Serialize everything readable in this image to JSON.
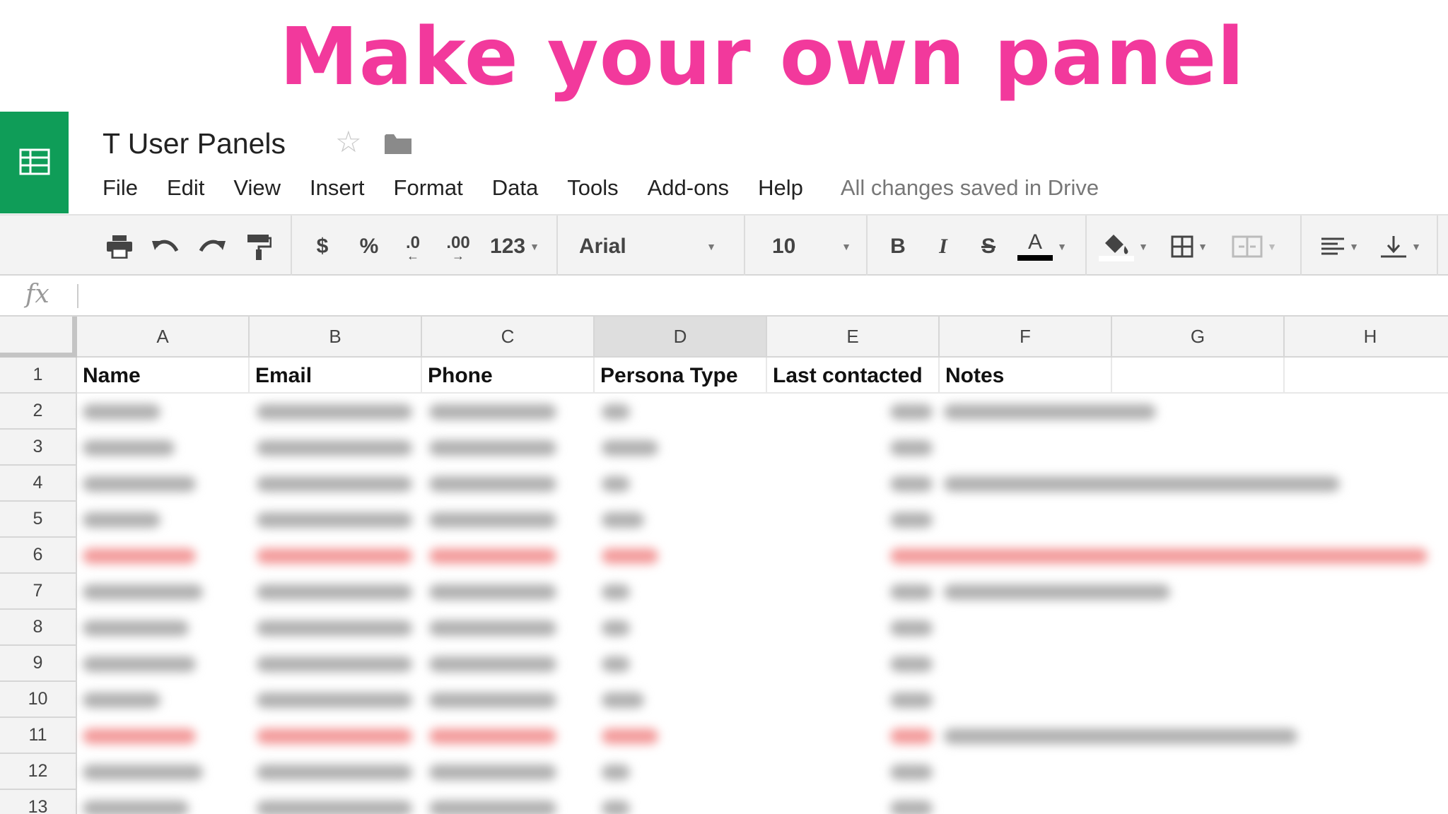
{
  "headline": "Make your own panel",
  "document": {
    "title": "T User Panels"
  },
  "icons": {
    "logo": "sheets-logo-icon",
    "star": "star-outline-icon",
    "folder": "folder-icon",
    "fx": "function-icon"
  },
  "menu": [
    "File",
    "Edit",
    "View",
    "Insert",
    "Format",
    "Data",
    "Tools",
    "Add-ons",
    "Help"
  ],
  "save_status": "All changes saved in Drive",
  "toolbar": {
    "currency": "$",
    "percent": "%",
    "decrease_decimals": ".0",
    "increase_decimals": ".00",
    "number_format": "123",
    "font": "Arial",
    "font_size": "10",
    "bold": "B",
    "italic": "I",
    "strikethrough": "S",
    "text_color": "A"
  },
  "formula_bar": {
    "fx_label": "fx",
    "value": ""
  },
  "columns": [
    "A",
    "B",
    "C",
    "D",
    "E",
    "F",
    "G",
    "H"
  ],
  "selected_column": "D",
  "row_numbers": [
    "1",
    "2",
    "3",
    "4",
    "5",
    "6",
    "7",
    "8",
    "9",
    "10",
    "11",
    "12",
    "13"
  ],
  "header_row": [
    "Name",
    "Email",
    "Phone",
    "Persona Type",
    "Last contacted",
    "Notes"
  ],
  "colors": {
    "headline": "#f2399c",
    "sheets_green": "#0f9d58",
    "highlight_rows": "#f39b9b"
  },
  "highlighted_rows": [
    "6",
    "11"
  ]
}
